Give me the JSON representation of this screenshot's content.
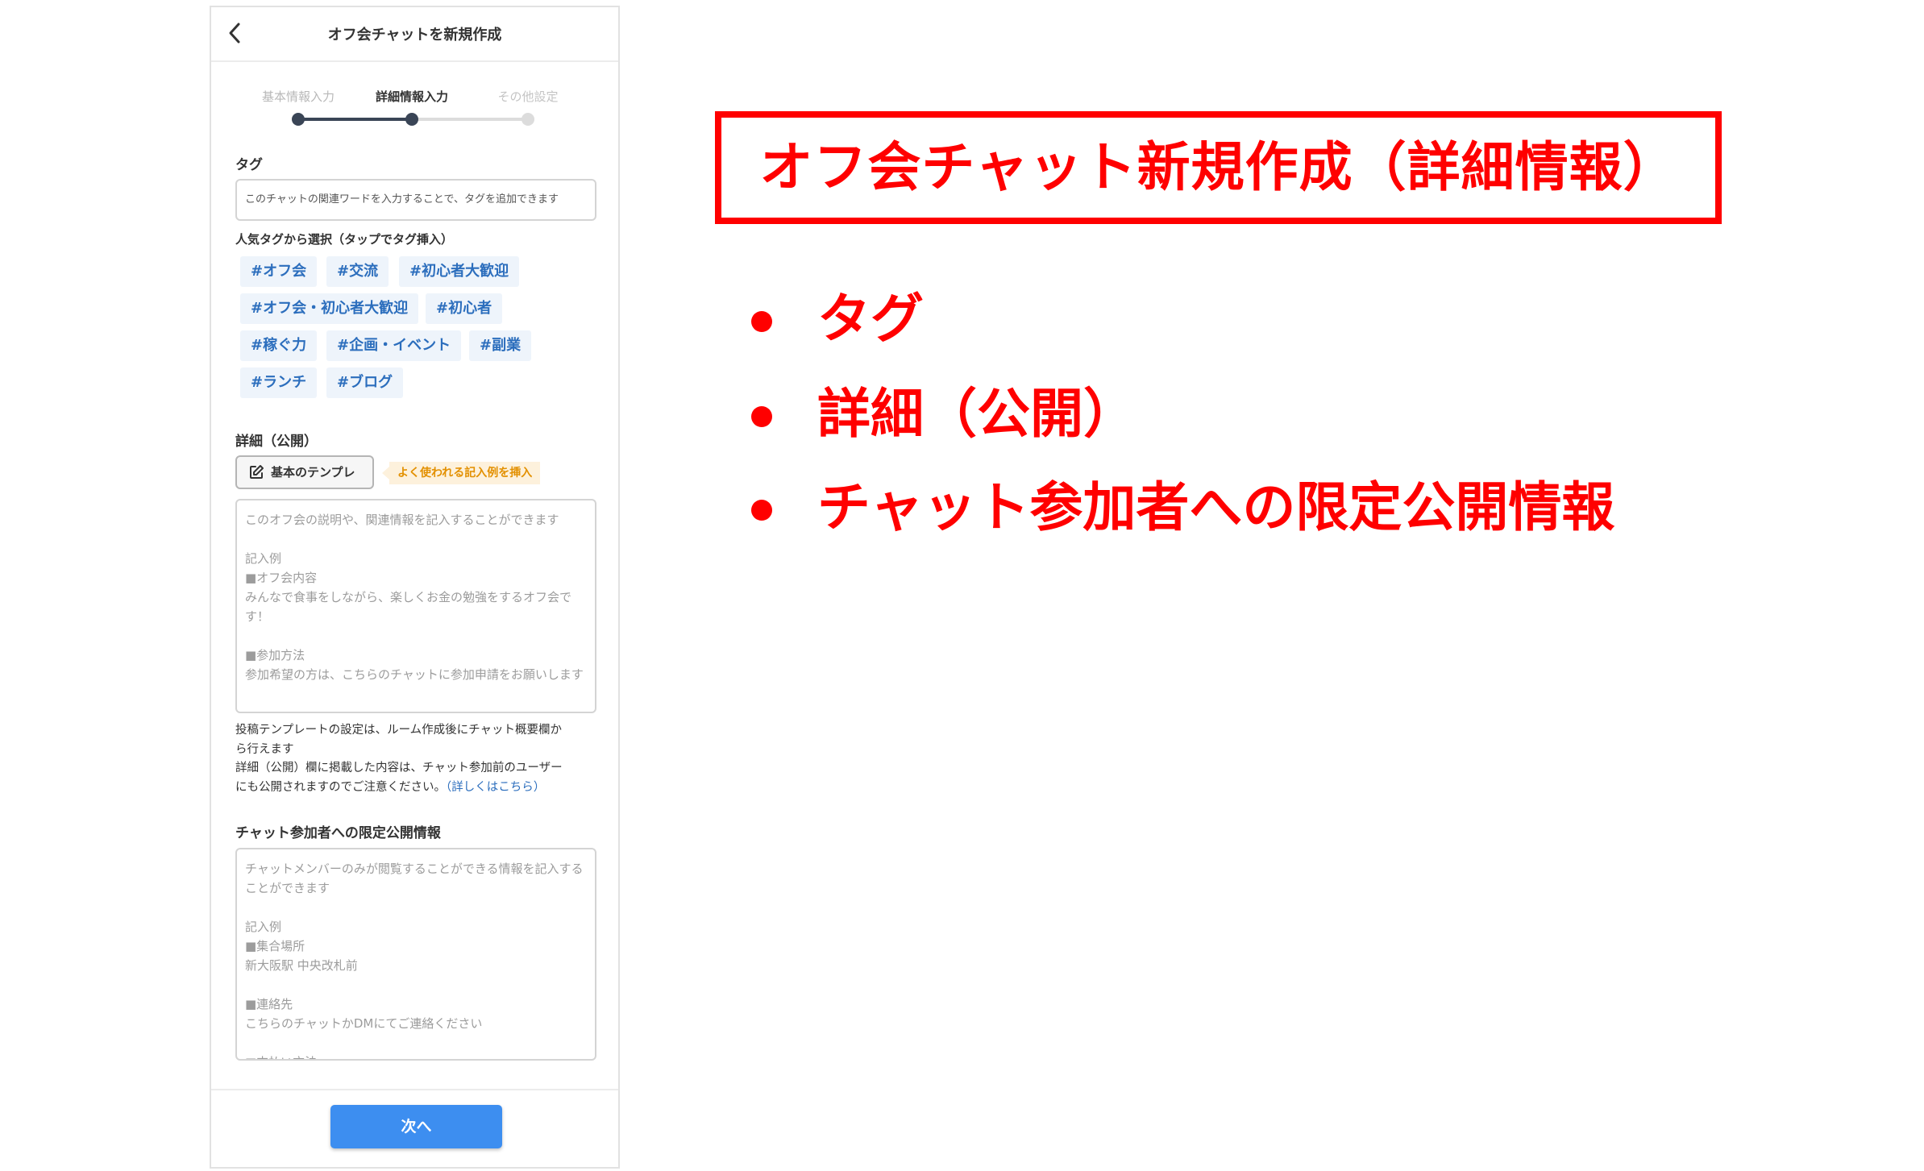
{
  "app": {
    "title": "オフ会チャットを新規作成",
    "steps": [
      {
        "label": "基本情報入力",
        "state": "done"
      },
      {
        "label": "詳細情報入力",
        "state": "active"
      },
      {
        "label": "その他設定",
        "state": "todo"
      }
    ],
    "tag_section": {
      "label": "タグ",
      "placeholder": "このチャットの関連ワードを入力することで、タグを追加できます",
      "popular_label": "人気タグから選択（タップでタグ挿入）",
      "tags": [
        "#オフ会",
        "#交流",
        "#初心者大歓迎",
        "#オフ会・初心者大歓迎",
        "#初心者",
        "#稼ぐ力",
        "#企画・イベント",
        "#副業",
        "#ランチ",
        "#ブログ"
      ]
    },
    "detail_section": {
      "label": "詳細（公開）",
      "template_button": "基本のテンプレ",
      "template_hint": "よく使われる記入例を挿入",
      "placeholder": "このオフ会の説明や、関連情報を記入することができます\n\n記入例\n■オフ会内容\nみんなで食事をしながら、楽しくお金の勉強をするオフ会です！\n\n■参加方法\n参加希望の方は、こちらのチャットに参加申請をお願いします",
      "note_line1": "投稿テンプレートの設定は、ルーム作成後にチャット概要欄か",
      "note_line2": "ら行えます",
      "note_line3": "詳細（公開）欄に掲載した内容は、チャット参加前のユーザー",
      "note_line4": "にも公開されますのでご注意ください。",
      "note_link": "（詳しくはこちら）"
    },
    "limited_section": {
      "label": "チャット参加者への限定公開情報",
      "placeholder": "チャットメンバーのみが閲覧することができる情報を記入することができます\n\n記入例\n■集合場所\n新大阪駅 中央改札前\n\n■連絡先\nこちらのチャットかDMにてご連絡ください\n\n■支払い方法"
    },
    "next_button": "次へ"
  },
  "annotation": {
    "headline": "オフ会チャット新規作成（詳細情報）",
    "bullets": [
      "タグ",
      "詳細（公開）",
      "チャット参加者への限定公開情報"
    ],
    "color": "#ff0000"
  },
  "colors": {
    "accent": "#3d8ef0",
    "tag_text": "#2c6ebd",
    "tag_bg": "#eef4fb",
    "step_active": "#3a4556",
    "hint_text": "#e39000"
  }
}
